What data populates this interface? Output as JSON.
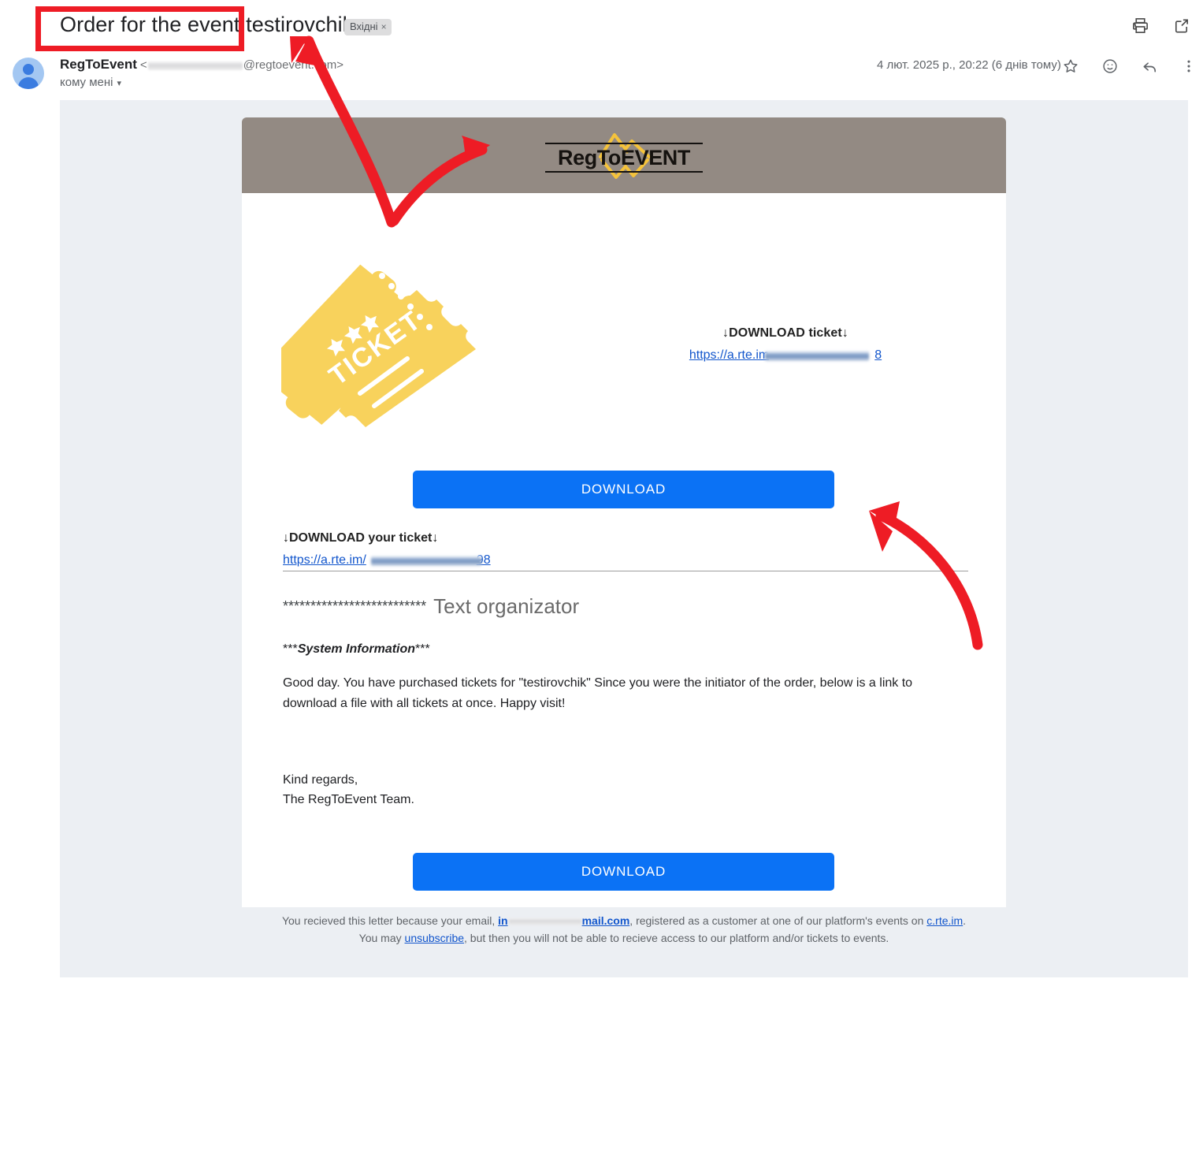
{
  "mail_header": {
    "subject": "Order for the event testirovchik",
    "label_chip": "Вхідні",
    "label_chip_close": "×",
    "sender_name": "RegToEvent",
    "sender_addr_prefix": "<",
    "sender_addr_suffix": "@regtoevent.com>",
    "to_line": "кому мені",
    "to_caret": "▾",
    "date": "4 лют. 2025 р., 20:22 (6 днів тому)",
    "print_icon": "print-icon",
    "open_new_window_icon": "open-in-new-window-icon",
    "star_icon": "star-icon",
    "emoji_icon": "emoji-reaction-icon",
    "reply_icon": "reply-icon",
    "more_icon": "more-options-icon"
  },
  "email": {
    "logo_text": "RegToEVENT",
    "logo_mark_icon": "mountain-diamond-logo-icon",
    "ticket_art_icon": "two-tickets-icon",
    "ticket_art_label": "TICKET",
    "download_ticket_title": "↓DOWNLOAD ticket↓",
    "download_ticket_link_visible": "https://a.rte.im",
    "download_ticket_link_tail": "8",
    "download_button_label": "DOWNLOAD",
    "your_ticket_title": "↓DOWNLOAD your ticket↓",
    "your_ticket_link_visible": "https://a.rte.im/",
    "your_ticket_link_tail": "98",
    "organizer_stars": "**************************",
    "organizer_title": "Text organizator",
    "system_info_prefix": "***",
    "system_info_label": "System Information",
    "system_info_suffix": "***",
    "body_paragraph": "Good day. You have purchased tickets for \"testirovchik\" Since you were the initiator of the order, below is a link to download a file with all tickets at once. Happy visit!",
    "signoff_line1": "Kind regards,",
    "signoff_line2": "The RegToEvent Team.",
    "download_button_label_2": "DOWNLOAD"
  },
  "footer": {
    "line1_part1": "You recieved this letter because your email, ",
    "line1_email_prefix": "in",
    "line1_email_suffix": "mail.com",
    "line1_part2": ", registered as a customer at one of our platform's events on ",
    "line1_site": "c.rte.im",
    "line1_end": ".",
    "line2_part1": "You may ",
    "line2_unsubscribe": "unsubscribe",
    "line2_part2": ", but then you will not be able to recieve access to our platform and/or tickets to events."
  },
  "annotations": {
    "highlight_box_color": "#ee1c25",
    "arrow_color": "#ee1c25",
    "arrow_1": "red-arrow-to-subject",
    "arrow_2": "red-arrow-to-logo",
    "arrow_3": "red-arrow-to-divider"
  },
  "colors": {
    "button_blue": "#0b72f5",
    "banner_gray": "#938a83",
    "canvas_bg": "#eceff3",
    "ticket_yellow": "#f8d25c",
    "link_blue": "#1155cc"
  }
}
